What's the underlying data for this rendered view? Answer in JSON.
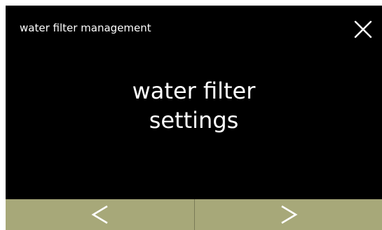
{
  "header": {
    "title": "water filter management",
    "close_icon": "close-icon"
  },
  "main": {
    "line1": "water filter",
    "line2": "settings"
  },
  "footer": {
    "prev_icon": "chevron-left-icon",
    "next_icon": "chevron-right-icon",
    "button_color": "#a7a879"
  },
  "colors": {
    "background": "#000000",
    "text": "#ffffff",
    "accent": "#a7a879"
  }
}
